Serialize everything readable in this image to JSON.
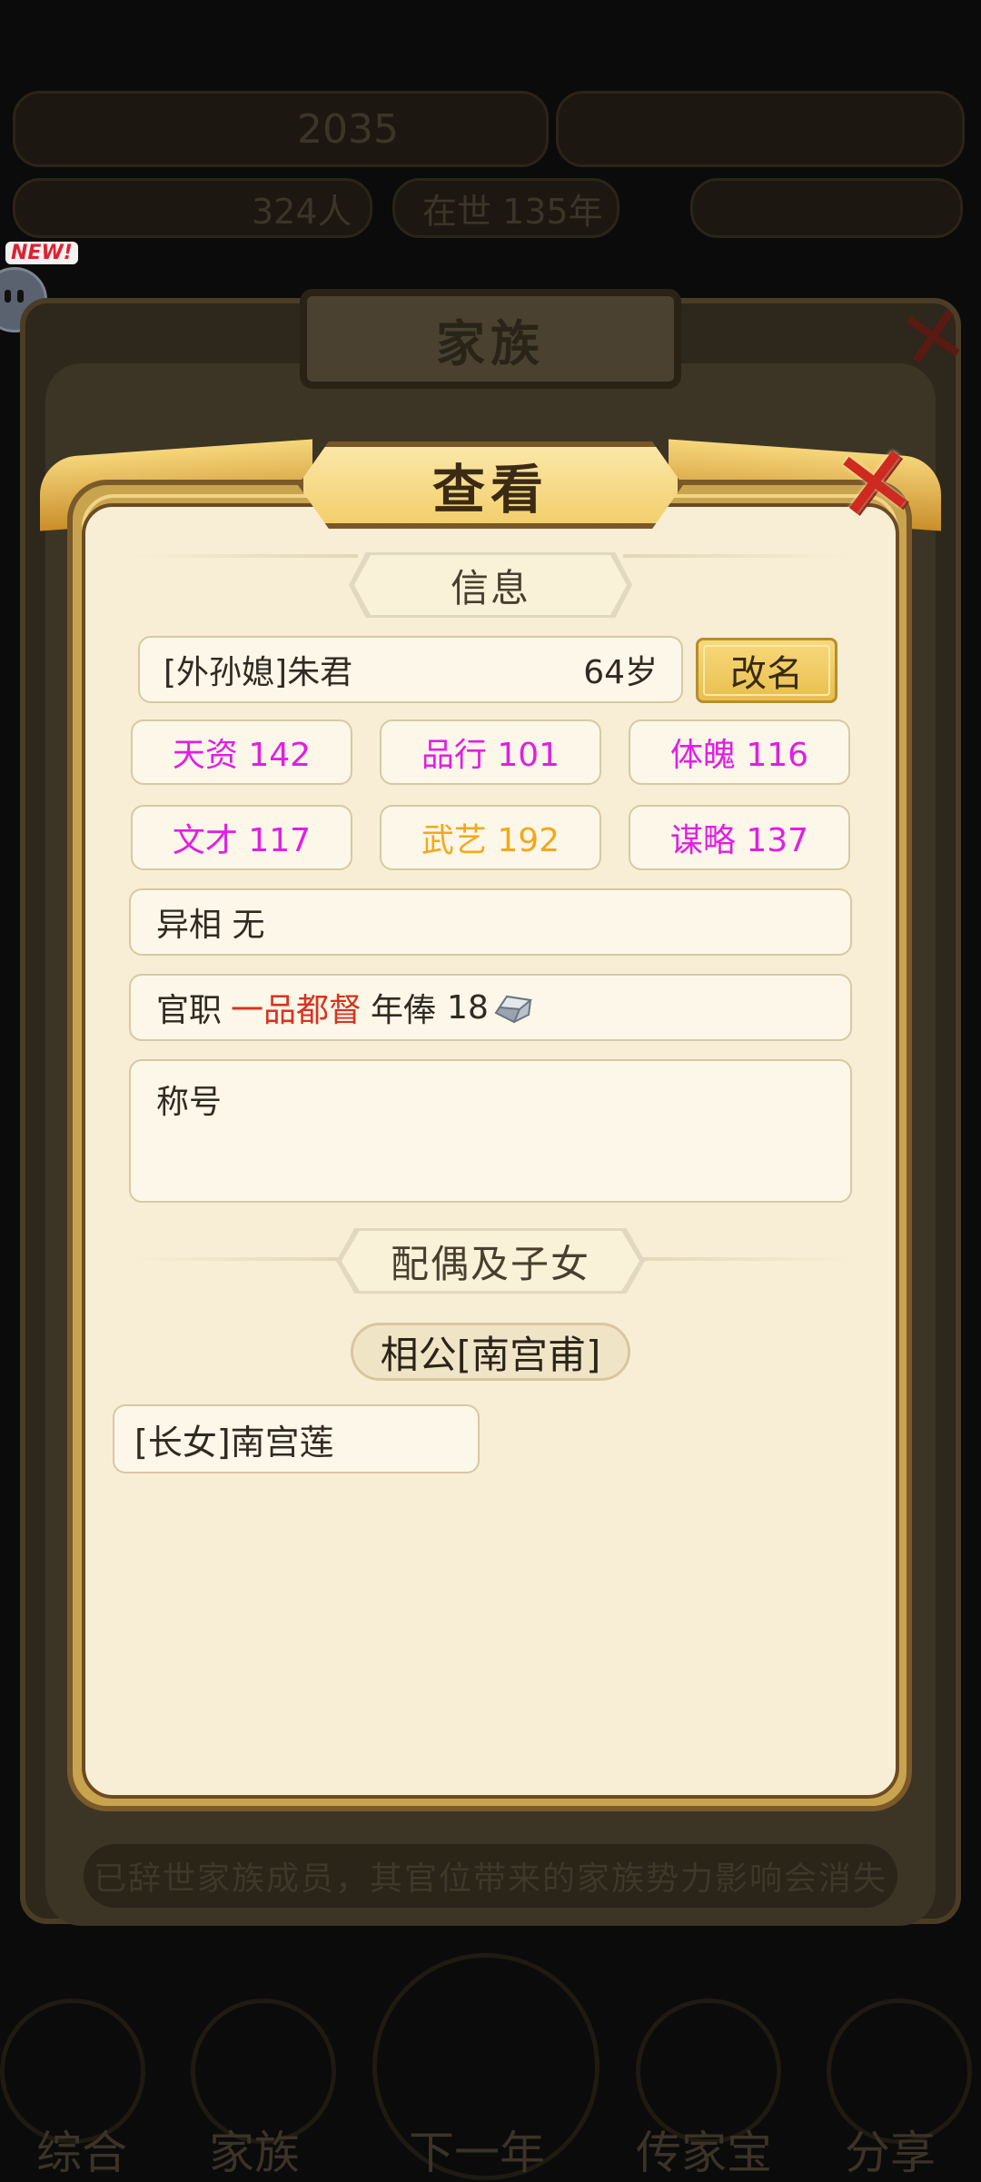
{
  "background": {
    "family_title": "家族",
    "new_badge": "NEW!",
    "footer_note": "已辞世家族成员，其官位带来的家族势力影响会消失",
    "top_bar_1": "2035",
    "top_bar_2": "324人",
    "top_bar_3": "在世 135年",
    "bottom_tabs": [
      "综合",
      "家族",
      "下一年",
      "传家宝",
      "分享"
    ]
  },
  "dialog": {
    "title": "查看",
    "info_section_title": "信息",
    "member": {
      "name": "[外孙媳]朱君",
      "age": "64岁",
      "rename_label": "改名"
    },
    "stats": [
      {
        "label": "天资 142",
        "color": "pink"
      },
      {
        "label": "品行 101",
        "color": "pink"
      },
      {
        "label": "体魄 116",
        "color": "pink"
      },
      {
        "label": "文才 117",
        "color": "pink"
      },
      {
        "label": "武艺 192",
        "color": "orange"
      },
      {
        "label": "谋略 137",
        "color": "pink"
      }
    ],
    "trait": "异相 无",
    "office": {
      "label": "官职",
      "rank": "一品都督",
      "salary_label": "年俸",
      "salary": "18"
    },
    "title_box_label": "称号",
    "spouse_section_title": "配偶及子女",
    "spouse": "相公[南宫甫]",
    "children": [
      "[长女]南宫莲"
    ]
  },
  "colors": {
    "stat_pink": "#e11ee6",
    "stat_orange": "#f3a81c",
    "rank_red": "#d9321f",
    "close_red": "#cf2a20"
  }
}
